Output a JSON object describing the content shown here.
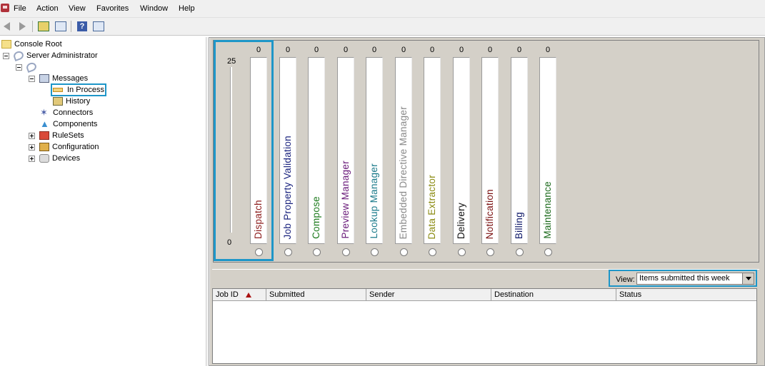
{
  "menu": [
    "File",
    "Action",
    "View",
    "Favorites",
    "Window",
    "Help"
  ],
  "toolbar": {
    "buttons": [
      "back-icon",
      "forward-icon",
      "up-folder-icon",
      "show-hide-tree-icon",
      "help-icon",
      "show-hide-action-pane-icon"
    ]
  },
  "tree": {
    "console_root": "Console Root",
    "server_admin": "Server Administrator",
    "messages": "Messages",
    "in_process": "In Process",
    "history": "History",
    "connectors": "Connectors",
    "components": "Components",
    "rulesets": "RuleSets",
    "configuration": "Configuration",
    "devices": "Devices"
  },
  "gauges": {
    "scale_max": "25",
    "scale_min": "0",
    "columns": [
      {
        "label": "Dispatch",
        "count": "0",
        "color": "#8b1a1a"
      },
      {
        "label": "Job Property Validation",
        "count": "0",
        "color": "#1a237e"
      },
      {
        "label": "Compose",
        "count": "0",
        "color": "#1b7a1b"
      },
      {
        "label": "Preview Manager",
        "count": "0",
        "color": "#6a1b7a"
      },
      {
        "label": "Lookup Manager",
        "count": "0",
        "color": "#1a7a8a"
      },
      {
        "label": "Embedded Directive Manager",
        "count": "0",
        "color": "#8a8a8a"
      },
      {
        "label": "Data Extractor",
        "count": "0",
        "color": "#8a8a10"
      },
      {
        "label": "Delivery",
        "count": "0",
        "color": "#111111"
      },
      {
        "label": "Notification",
        "count": "0",
        "color": "#7a1010"
      },
      {
        "label": "Billing",
        "count": "0",
        "color": "#101a6a"
      },
      {
        "label": "Maintenance",
        "count": "0",
        "color": "#1b6a1b"
      }
    ]
  },
  "view": {
    "label": "View:",
    "selected": "Items submitted this week"
  },
  "table": {
    "columns": [
      "Job ID",
      "Submitted",
      "Sender",
      "Destination",
      "Status"
    ]
  }
}
